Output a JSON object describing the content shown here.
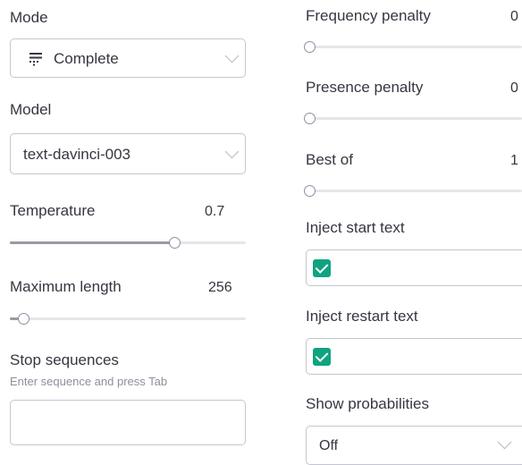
{
  "left": {
    "mode_label": "Mode",
    "mode_value": "Complete",
    "model_label": "Model",
    "model_value": "text-davinci-003",
    "temperature_label": "Temperature",
    "temperature_value": "0.7",
    "temperature_fraction": 0.7,
    "max_length_label": "Maximum length",
    "max_length_value": "256",
    "max_length_fraction": 0.06,
    "stop_label": "Stop sequences",
    "stop_hint": "Enter sequence and press Tab"
  },
  "right": {
    "freq_label": "Frequency penalty",
    "freq_value": "0",
    "presence_label": "Presence penalty",
    "presence_value": "0",
    "bestof_label": "Best of",
    "bestof_value": "1",
    "inject_start_label": "Inject start text",
    "inject_restart_label": "Inject restart text",
    "show_prob_label": "Show probabilities",
    "show_prob_value": "Off"
  },
  "colors": {
    "accent": "#10a37f"
  },
  "icons": {
    "mode_icon": "complete-lines-icon"
  }
}
